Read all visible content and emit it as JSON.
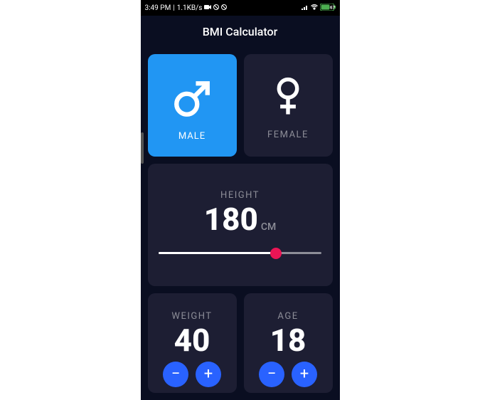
{
  "statusBar": {
    "time": "3:49 PM",
    "network": "1.1KB/s",
    "icons_left": "🎥 @ @",
    "icons_right": "📶 📶 🔋",
    "battery_text": "67%"
  },
  "appbar": {
    "title": "BMI Calculator"
  },
  "gender": {
    "male": {
      "label": "MALE",
      "selected": true
    },
    "female": {
      "label": "FEMALE",
      "selected": false
    }
  },
  "height": {
    "title": "HEIGHT",
    "value": "180",
    "unit": "CM",
    "percent": 72
  },
  "weight": {
    "title": "WEIGHT",
    "value": "40",
    "minus": "−",
    "plus": "+"
  },
  "age": {
    "title": "AGE",
    "value": "18",
    "minus": "−",
    "plus": "+"
  },
  "colors": {
    "background": "#0a0e21",
    "card": "#1d1e33",
    "selected": "#2196f3",
    "accent": "#eb1555",
    "button": "#2962ff",
    "muted": "#8d8e98"
  }
}
